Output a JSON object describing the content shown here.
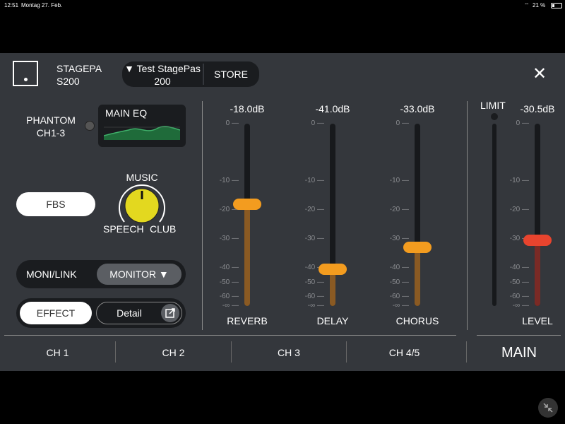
{
  "status_bar": {
    "time": "12:51",
    "date": "Montag 27. Feb.",
    "battery": "21 %"
  },
  "header": {
    "device_line1": "STAGEPA",
    "device_line2": "S200",
    "preset_line1": "▼ Test StagePas",
    "preset_line2": "200",
    "store_label": "STORE",
    "close_glyph": "✕"
  },
  "left": {
    "phantom_line1": "PHANTOM",
    "phantom_line2": "CH1-3",
    "main_eq_label": "MAIN EQ",
    "fbs_label": "FBS",
    "knob": {
      "top": "MUSIC",
      "left": "SPEECH",
      "right": "CLUB"
    },
    "moni_link_label": "MONI/LINK",
    "monitor_label": "MONITOR ▼",
    "effect_label": "EFFECT",
    "detail_label": "Detail"
  },
  "scale_labels": [
    "0",
    "-10",
    "-20",
    "-30",
    "-40",
    "-50",
    "-60",
    "-∞"
  ],
  "faders": [
    {
      "name": "REVERB",
      "value_label": "-18.0dB",
      "value_db": -18.0,
      "color": "#f39c1f",
      "fill": "#8a5a23"
    },
    {
      "name": "DELAY",
      "value_label": "-41.0dB",
      "value_db": -41.0,
      "color": "#f39c1f",
      "fill": "#8a5a23"
    },
    {
      "name": "CHORUS",
      "value_label": "-33.0dB",
      "value_db": -33.0,
      "color": "#f39c1f",
      "fill": "#8a5a23"
    }
  ],
  "main_fader": {
    "limit_label": "LIMIT",
    "name": "LEVEL",
    "value_label": "-30.5dB",
    "value_db": -30.5,
    "color": "#e8442e",
    "fill": "#7a2a25"
  },
  "tabs": [
    "CH 1",
    "CH 2",
    "CH 3",
    "CH 4/5",
    "MAIN"
  ]
}
